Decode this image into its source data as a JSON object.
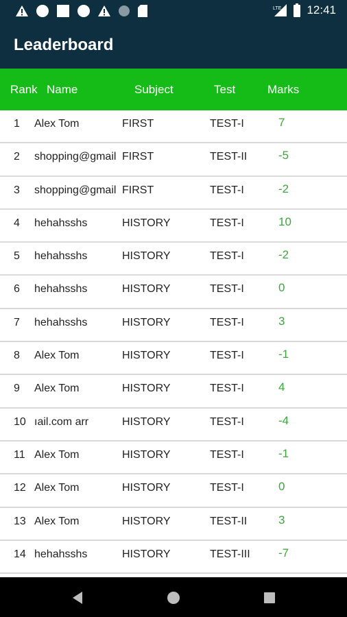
{
  "status_bar": {
    "time": "12:41",
    "network_label": "LTE",
    "icons": [
      "warning-icon",
      "circle-icon",
      "square-icon",
      "circle-icon",
      "warning-icon",
      "circle-dim-icon",
      "sd-card-icon",
      "signal-icon",
      "battery-icon"
    ]
  },
  "app_bar": {
    "title": "Leaderboard",
    "background": "#0d2f3f"
  },
  "table": {
    "accent": "#15bb16",
    "marks_color": "#3aa83a",
    "headers": {
      "rank": "Rank",
      "name": "Name",
      "subject": "Subject",
      "test": "Test",
      "marks": "Marks"
    },
    "rows": [
      {
        "rank": "1",
        "name": "Alex Tom",
        "subject": "FIRST",
        "test": "TEST-I",
        "marks": "7"
      },
      {
        "rank": "2",
        "name": "shopping@gmail",
        "subject": "FIRST",
        "test": "TEST-II",
        "marks": "-5"
      },
      {
        "rank": "3",
        "name": "shopping@gmail",
        "subject": "FIRST",
        "test": "TEST-I",
        "marks": "-2"
      },
      {
        "rank": "4",
        "name": "hehahsshs",
        "subject": "HISTORY",
        "test": "TEST-I",
        "marks": "10"
      },
      {
        "rank": "5",
        "name": "hehahsshs",
        "subject": "HISTORY",
        "test": "TEST-I",
        "marks": "-2"
      },
      {
        "rank": "6",
        "name": "hehahsshs",
        "subject": "HISTORY",
        "test": "TEST-I",
        "marks": "0"
      },
      {
        "rank": "7",
        "name": "hehahsshs",
        "subject": "HISTORY",
        "test": "TEST-I",
        "marks": "3"
      },
      {
        "rank": "8",
        "name": "Alex Tom",
        "subject": "HISTORY",
        "test": "TEST-I",
        "marks": "-1"
      },
      {
        "rank": "9",
        "name": "Alex Tom",
        "subject": "HISTORY",
        "test": "TEST-I",
        "marks": "4"
      },
      {
        "rank": "10",
        "name": "ıail.com         arr",
        "subject": "HISTORY",
        "test": "TEST-I",
        "marks": "-4"
      },
      {
        "rank": "11",
        "name": "Alex Tom",
        "subject": "HISTORY",
        "test": "TEST-I",
        "marks": "-1"
      },
      {
        "rank": "12",
        "name": "Alex Tom",
        "subject": "HISTORY",
        "test": "TEST-I",
        "marks": "0"
      },
      {
        "rank": "13",
        "name": "Alex Tom",
        "subject": "HISTORY",
        "test": "TEST-II",
        "marks": "3"
      },
      {
        "rank": "14",
        "name": "hehahsshs",
        "subject": "HISTORY",
        "test": "TEST-III",
        "marks": "-7"
      }
    ]
  },
  "nav_bar": {
    "buttons": [
      "back-icon",
      "home-icon",
      "recents-icon"
    ]
  }
}
